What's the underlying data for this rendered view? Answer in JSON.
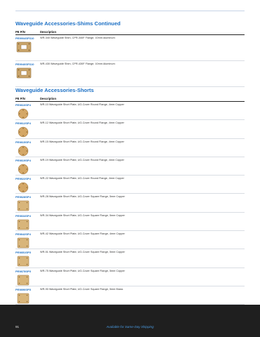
{
  "shims": {
    "title": "Waveguide Accessories-Shims Continued",
    "col_pn": "PE P/N",
    "col_desc": "Description",
    "rows": [
      {
        "pn": "PE9904SFS10",
        "desc": "WR-340 Waveguide Shim, CPR-340F Flange, 10mm Aluminum"
      },
      {
        "pn": "PE9940SFS10",
        "desc": "WR-430 Waveguide Shim, CPR-430F Flange, 10mm Aluminum"
      }
    ]
  },
  "shorts": {
    "title": "Waveguide Accessories-Shorts",
    "col_pn": "PE P/N",
    "col_desc": "Description",
    "rows": [
      {
        "pn": "PE9810SP4",
        "desc": "WR-10 Waveguide Short Plate, UG-Cover Round Flange, 4mm Copper"
      },
      {
        "pn": "PE9812SP4",
        "desc": "WR-12 Waveguide Short Plate, UG-Cover Round Flange, 4mm Copper"
      },
      {
        "pn": "PE9815SP4",
        "desc": "WR-15 Waveguide Short Plate, UG-Cover Round Flange, 4mm Copper"
      },
      {
        "pn": "PE9819SP4",
        "desc": "WR-19 Waveguide Short Plate, UG-Cover Round Flange, 4mm Copper"
      },
      {
        "pn": "PE9822SP4",
        "desc": "WR-22 Waveguide Short Plate, UG-Cover Round Flange, 4mm Copper"
      },
      {
        "pn": "PE9828SP4",
        "desc": "WR-28 Waveguide Short Plate, UG-Cover Square Flange, 5mm Copper"
      },
      {
        "pn": "PE9834SP4",
        "desc": "WR-34 Waveguide Short Plate, UG-Cover Square Flange, 5mm Copper"
      },
      {
        "pn": "PE9842SP4",
        "desc": "WR-42 Waveguide Short Plate, UG-Cover Square Flange, 4mm Copper"
      },
      {
        "pn": "PE9851SP5",
        "desc": "WR-51 Waveguide Short Plate, UG-Cover Square Flange, 5mm Copper"
      },
      {
        "pn": "PE9875SP5",
        "desc": "WR-75 Waveguide Short Plate, UG-Cover Square Flange, 5mm Copper"
      },
      {
        "pn": "PE9890SP5",
        "desc": "WR-90 Waveguide Short Plate, UG-Cover Square Flange, 5mm Brass"
      },
      {
        "pn": "PE98112SP5",
        "desc": "WR-112 Waveguide Short Plate, UG-Cover Square Flange, 5mm Copper"
      }
    ]
  },
  "footer": {
    "page": "91",
    "tagline": "Available for Same-Day Shipping",
    "bar_color": "#1f1f1f",
    "accent_color": "#1b6fc4"
  }
}
